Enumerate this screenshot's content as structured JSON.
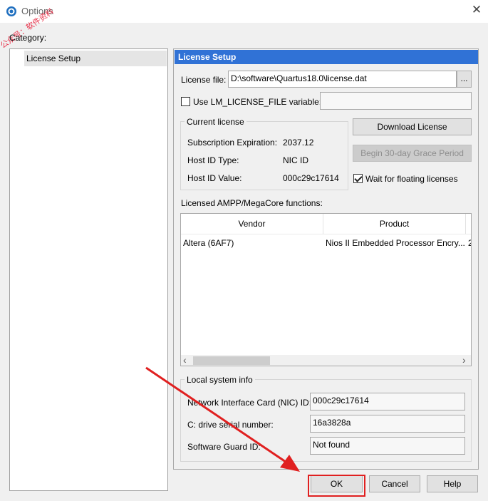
{
  "window": {
    "title": "Options",
    "close_symbol": "✕"
  },
  "watermark": {
    "text": "公众号：软件资料"
  },
  "category_label": "Category:",
  "tree": {
    "items": [
      {
        "label": "License Setup",
        "selected": true
      }
    ]
  },
  "panel": {
    "header": "License Setup",
    "license_file_label": "License file:",
    "license_file_value": "D:\\software\\Quartus18.0\\license.dat",
    "browse_label": "...",
    "use_lm_label": "Use LM_LICENSE_FILE variable:",
    "use_lm_checked": false,
    "use_lm_value": "",
    "current_license": {
      "title": "Current license",
      "rows": [
        {
          "label": "Subscription Expiration:",
          "value": "2037.12"
        },
        {
          "label": "Host ID Type:",
          "value": "NIC ID"
        },
        {
          "label": "Host ID Value:",
          "value": "000c29c17614"
        }
      ]
    },
    "download_button": "Download License",
    "grace_button": "Begin 30-day Grace Period",
    "wait_label": "Wait for floating licenses",
    "wait_checked": true,
    "functions_label": "Licensed AMPP/MegaCore functions:",
    "table": {
      "columns": [
        "Vendor",
        "Product"
      ],
      "rows": [
        {
          "vendor": "Altera (6AF7)",
          "product": "Nios II Embedded Processor Encry...",
          "extra": "2"
        }
      ]
    },
    "local_info": {
      "title": "Local system info",
      "rows": [
        {
          "label": "Network Interface Card (NIC) ID:",
          "value": "000c29c17614"
        },
        {
          "label": "C: drive serial number:",
          "value": "16a3828a"
        },
        {
          "label": "Software Guard ID:",
          "value": "Not found"
        }
      ]
    }
  },
  "buttons": {
    "ok": "OK",
    "cancel": "Cancel",
    "help": "Help"
  },
  "scroll": {
    "left_arrow": "‹",
    "right_arrow": "›"
  },
  "colors": {
    "header_bg": "#3072d6",
    "highlight_red": "#e02020"
  }
}
